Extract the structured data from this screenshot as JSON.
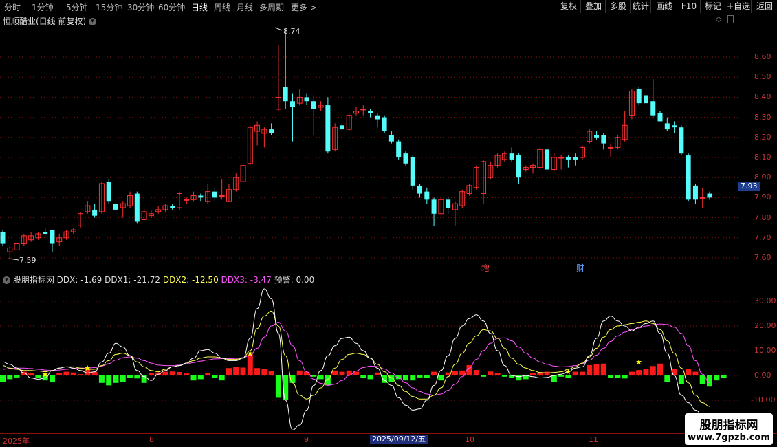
{
  "toolbar": {
    "periods": [
      "分时",
      "1分钟",
      "5分钟",
      "15分钟",
      "30分钟",
      "60分钟",
      "日线",
      "周线",
      "月线",
      "多周期",
      "更多"
    ],
    "right_buttons": [
      "复权",
      "叠加",
      "多股",
      "统计",
      "画线",
      "F10",
      "+自选",
      "返回"
    ],
    "mark_label": "标记"
  },
  "main": {
    "title": "恒顺醋业(日线 前复权)",
    "high_label": "8.74",
    "low_label": "7.59",
    "last_price": "7.93",
    "y_ticks": [
      "8.60",
      "8.50",
      "8.40",
      "8.30",
      "8.20",
      "8.10",
      "8.00",
      "7.90",
      "7.80",
      "7.70",
      "7.60"
    ],
    "event_markers": [
      "增",
      "财"
    ]
  },
  "indicator": {
    "name": "股朋指标网",
    "ddx": "DDX: -1.69",
    "ddx1": "DDX1: -21.72",
    "ddx2": "DDX2: -12.50",
    "ddx3": "DDX3: -3.47",
    "alert": "预警: 0.00",
    "y_ticks": [
      "30.00",
      "20.00",
      "10.00",
      "0.00",
      "-10.00"
    ]
  },
  "xaxis": {
    "labels": [
      "2025年",
      "8",
      "9",
      "2025/09/12/五",
      "10",
      "11"
    ]
  },
  "watermark": {
    "line1": "股朋指标网",
    "line2": "www.7gpzb.com"
  },
  "colors": {
    "up": "#ff3232",
    "down": "#54fcfc",
    "ddx1": "#ffffff",
    "ddx2": "#ffff54",
    "ddx3": "#ff54ff",
    "grid": "#8b1010"
  },
  "chart_data": {
    "type": "candlestick",
    "price_axis": {
      "ylim": [
        7.55,
        8.78
      ]
    },
    "candles": [
      [
        7.73,
        7.67,
        7.74,
        7.66
      ],
      [
        7.63,
        7.65,
        7.66,
        7.6
      ],
      [
        7.64,
        7.67,
        7.69,
        7.63
      ],
      [
        7.67,
        7.71,
        7.72,
        7.66
      ],
      [
        7.69,
        7.71,
        7.73,
        7.68
      ],
      [
        7.7,
        7.72,
        7.73,
        7.69
      ],
      [
        7.73,
        7.72,
        7.75,
        7.71
      ],
      [
        7.74,
        7.67,
        7.74,
        7.63
      ],
      [
        7.68,
        7.7,
        7.72,
        7.66
      ],
      [
        7.7,
        7.73,
        7.74,
        7.69
      ],
      [
        7.73,
        7.74,
        7.75,
        7.72
      ],
      [
        7.76,
        7.82,
        7.83,
        7.75
      ],
      [
        7.83,
        7.86,
        7.88,
        7.82
      ],
      [
        7.84,
        7.81,
        7.87,
        7.8
      ],
      [
        7.83,
        7.97,
        7.98,
        7.82
      ],
      [
        7.98,
        7.88,
        7.99,
        7.87
      ],
      [
        7.87,
        7.84,
        7.89,
        7.83
      ],
      [
        7.85,
        7.87,
        7.88,
        7.8
      ],
      [
        7.86,
        7.91,
        7.93,
        7.85
      ],
      [
        7.92,
        7.78,
        7.93,
        7.77
      ],
      [
        7.79,
        7.83,
        7.85,
        7.79
      ],
      [
        7.81,
        7.82,
        7.84,
        7.8
      ],
      [
        7.83,
        7.84,
        7.86,
        7.82
      ],
      [
        7.84,
        7.86,
        7.87,
        7.83
      ],
      [
        7.86,
        7.85,
        7.87,
        7.84
      ],
      [
        7.85,
        7.92,
        7.93,
        7.84
      ],
      [
        7.89,
        7.89,
        7.9,
        7.87
      ],
      [
        7.89,
        7.91,
        7.93,
        7.88
      ],
      [
        7.91,
        7.9,
        7.92,
        7.88
      ],
      [
        7.88,
        7.93,
        7.97,
        7.87
      ],
      [
        7.93,
        7.9,
        7.95,
        7.88
      ],
      [
        7.91,
        7.91,
        7.99,
        7.89
      ],
      [
        7.88,
        7.94,
        7.97,
        7.88
      ],
      [
        7.94,
        8.0,
        8.02,
        7.93
      ],
      [
        7.98,
        8.06,
        8.07,
        7.97
      ],
      [
        8.07,
        8.25,
        8.26,
        8.06
      ],
      [
        8.23,
        8.26,
        8.28,
        8.16
      ],
      [
        8.22,
        8.24,
        8.25,
        8.15
      ],
      [
        8.24,
        8.22,
        8.27,
        8.21
      ],
      [
        8.34,
        8.4,
        8.66,
        8.33
      ],
      [
        8.45,
        8.38,
        8.74,
        8.34
      ],
      [
        8.38,
        8.35,
        8.42,
        8.18
      ],
      [
        8.37,
        8.4,
        8.44,
        8.36
      ],
      [
        8.4,
        8.38,
        8.42,
        8.36
      ],
      [
        8.38,
        8.34,
        8.41,
        8.21
      ],
      [
        8.35,
        8.36,
        8.38,
        8.33
      ],
      [
        8.36,
        8.13,
        8.4,
        8.12
      ],
      [
        8.14,
        8.25,
        8.27,
        8.13
      ],
      [
        8.26,
        8.24,
        8.27,
        8.22
      ],
      [
        8.24,
        8.31,
        8.32,
        8.23
      ],
      [
        8.32,
        8.33,
        8.35,
        8.31
      ],
      [
        8.34,
        8.34,
        8.36,
        8.31
      ],
      [
        8.33,
        8.32,
        8.34,
        8.3
      ],
      [
        8.31,
        8.29,
        8.32,
        8.25
      ],
      [
        8.3,
        8.23,
        8.31,
        8.22
      ],
      [
        8.21,
        8.18,
        8.23,
        8.17
      ],
      [
        8.18,
        8.1,
        8.19,
        8.09
      ],
      [
        8.12,
        8.07,
        8.13,
        8.06
      ],
      [
        8.1,
        7.96,
        8.11,
        7.94
      ],
      [
        7.96,
        7.92,
        7.97,
        7.9
      ],
      [
        7.93,
        7.89,
        7.95,
        7.87
      ],
      [
        7.89,
        7.82,
        7.9,
        7.76
      ],
      [
        7.82,
        7.89,
        7.9,
        7.81
      ],
      [
        7.89,
        7.85,
        7.9,
        7.82
      ],
      [
        7.84,
        7.87,
        7.88,
        7.76
      ],
      [
        7.86,
        7.93,
        7.94,
        7.85
      ],
      [
        7.92,
        7.96,
        7.97,
        7.91
      ],
      [
        7.95,
        8.05,
        8.06,
        7.94
      ],
      [
        7.92,
        8.08,
        8.09,
        7.87
      ],
      [
        8.0,
        8.06,
        8.08,
        7.99
      ],
      [
        8.06,
        8.11,
        8.12,
        8.05
      ],
      [
        8.09,
        8.12,
        8.13,
        8.08
      ],
      [
        8.12,
        8.09,
        8.15,
        8.08
      ],
      [
        8.11,
        8.0,
        8.12,
        7.97
      ],
      [
        8.04,
        8.05,
        8.06,
        8.03
      ],
      [
        8.05,
        8.06,
        8.07,
        8.02
      ],
      [
        8.05,
        8.14,
        8.15,
        8.04
      ],
      [
        8.14,
        8.04,
        8.15,
        8.03
      ],
      [
        8.04,
        8.1,
        8.12,
        8.03
      ],
      [
        8.1,
        8.1,
        8.11,
        8.04
      ],
      [
        8.1,
        8.09,
        8.11,
        8.05
      ],
      [
        8.1,
        8.09,
        8.12,
        8.06
      ],
      [
        8.1,
        8.15,
        8.16,
        8.09
      ],
      [
        8.18,
        8.23,
        8.24,
        8.17
      ],
      [
        8.21,
        8.2,
        8.23,
        8.19
      ],
      [
        8.21,
        8.17,
        8.22,
        8.14
      ],
      [
        8.15,
        8.15,
        8.17,
        8.1
      ],
      [
        8.15,
        8.2,
        8.21,
        8.14
      ],
      [
        8.19,
        8.26,
        8.33,
        8.18
      ],
      [
        8.31,
        8.43,
        8.44,
        8.29
      ],
      [
        8.44,
        8.37,
        8.45,
        8.36
      ],
      [
        8.41,
        8.37,
        8.43,
        8.35
      ],
      [
        8.38,
        8.31,
        8.49,
        8.3
      ],
      [
        8.32,
        8.28,
        8.33,
        8.28
      ],
      [
        8.27,
        8.24,
        8.3,
        8.23
      ],
      [
        8.26,
        8.25,
        8.28,
        8.22
      ],
      [
        8.25,
        8.12,
        8.26,
        8.11
      ],
      [
        8.11,
        7.89,
        8.12,
        7.88
      ],
      [
        7.96,
        7.89,
        7.97,
        7.87
      ],
      [
        7.9,
        7.9,
        7.95,
        7.85
      ],
      [
        7.92,
        7.9,
        7.93,
        7.89
      ]
    ],
    "ddx_bars": [
      -2.5,
      -1.5,
      -0.8,
      1.5,
      1,
      -1,
      -2,
      -2.5,
      1,
      1.5,
      1.2,
      0.5,
      2.5,
      1.5,
      -3,
      -4,
      -3,
      -2.5,
      -1,
      -1.2,
      -3,
      1,
      1.2,
      1.5,
      1.6,
      1.4,
      0.8,
      -2,
      -1.5,
      1,
      -1,
      -2,
      3,
      3.5,
      3.2,
      8.5,
      3,
      2.5,
      1.8,
      -9,
      -10,
      -3,
      2,
      1.5,
      -0.5,
      -1.5,
      -4,
      2,
      1.5,
      2,
      1.5,
      -1,
      -1.5,
      1.2,
      -3,
      -2.5,
      -1.5,
      -2,
      -2,
      -0.8,
      -1,
      1.5,
      -2,
      1.2,
      1.8,
      2,
      4.2,
      2.2,
      -0.5,
      1.6,
      1,
      -0.5,
      -1,
      -2,
      -1.5,
      1,
      1.2,
      1.5,
      -2.5,
      -0.5,
      -1,
      1.5,
      1.5,
      4.2,
      4.5,
      4.8,
      -1,
      -1,
      -1.2,
      1.5,
      2.2,
      2.5,
      3.8,
      4.8,
      -2.5,
      2.5,
      -3.5,
      2.5,
      1.5,
      -3.5,
      -4.5,
      -2,
      -1
    ],
    "ddx1": [
      5.5,
      4.5,
      3,
      1,
      -1,
      -1.5,
      -1,
      2,
      3,
      3.5,
      3,
      2,
      1,
      1.5,
      5.5,
      9,
      13,
      11.5,
      8,
      2,
      -0.5,
      -2,
      0.5,
      2,
      3.5,
      4,
      5,
      7,
      10,
      10.5,
      9,
      7,
      6,
      6,
      7,
      15,
      27,
      35,
      31,
      17,
      -10,
      -22,
      -20,
      -14,
      -4,
      2,
      8,
      12,
      15,
      15.5,
      13,
      10,
      7,
      3,
      -2,
      -4,
      -9,
      -12,
      -14,
      -13.5,
      -10,
      -4,
      2,
      8,
      15,
      20,
      23,
      24.5,
      22,
      17,
      10,
      4,
      0,
      -0.5,
      0,
      -0.5,
      -1,
      -0.8,
      0,
      0.5,
      1.5,
      3,
      3.5,
      8,
      15,
      22,
      24,
      22,
      20,
      18,
      19.5,
      21,
      22,
      17,
      9,
      0,
      -8,
      -11,
      -14,
      -16,
      -16
    ],
    "ddx2": [
      4,
      3,
      2.5,
      2,
      2,
      1.8,
      1.5,
      2,
      3,
      3.5,
      3.5,
      3,
      2.5,
      2.5,
      4,
      6,
      8.5,
      9,
      8,
      5.5,
      3.5,
      2,
      1.5,
      2.5,
      3.5,
      4,
      5,
      6,
      7,
      7.5,
      7.5,
      7,
      6.5,
      6.5,
      7,
      10,
      19,
      24,
      26,
      20,
      8,
      -3,
      -8,
      -9.5,
      -8,
      -5,
      -1.5,
      3,
      6.5,
      8.5,
      9,
      8.5,
      7,
      4.5,
      1.5,
      -1,
      -4,
      -6.5,
      -8.5,
      -9.5,
      -9.5,
      -8,
      -5,
      -0.5,
      4.5,
      9,
      13,
      16,
      18.5,
      18,
      15,
      11,
      7,
      4.5,
      3,
      2,
      1.2,
      1,
      1.2,
      1.5,
      2.5,
      3.5,
      5,
      7.5,
      11,
      15.5,
      18.5,
      20,
      20.5,
      21,
      21.5,
      22,
      21,
      18.5,
      14,
      9,
      3,
      -3,
      -8,
      -11,
      -12.5
    ],
    "ddx3": [
      2.5,
      2.8,
      3,
      3,
      2.8,
      2.5,
      2.2,
      2,
      2.2,
      2.5,
      2.8,
      3,
      3,
      3.2,
      3.8,
      4.8,
      6.2,
      7.2,
      7.5,
      7,
      6,
      5,
      4.2,
      4,
      4,
      4.2,
      4.6,
      5.2,
      5.8,
      6.3,
      6.7,
      6.8,
      6.8,
      6.9,
      7.2,
      8.2,
      11,
      15.5,
      20,
      21.5,
      18,
      12,
      6,
      1.5,
      -1.5,
      -3.2,
      -4,
      -3.5,
      -2,
      0,
      1.8,
      3.2,
      3.8,
      3.6,
      2.6,
      1,
      -1,
      -3,
      -5,
      -6.5,
      -7.5,
      -8,
      -7.5,
      -6,
      -3.5,
      -0.5,
      3,
      6.5,
      10,
      13,
      15,
      15.2,
      14,
      11.5,
      9,
      7,
      5.5,
      4.5,
      3.8,
      3.5,
      3.6,
      4,
      4.8,
      6.2,
      8.2,
      11,
      13.8,
      16,
      17.5,
      18.5,
      19.2,
      20,
      20.5,
      20.8,
      20.6,
      19.5,
      17,
      12,
      6,
      0.5,
      -3
    ],
    "indicator_axis": {
      "ylim": [
        -14,
        36
      ]
    }
  }
}
